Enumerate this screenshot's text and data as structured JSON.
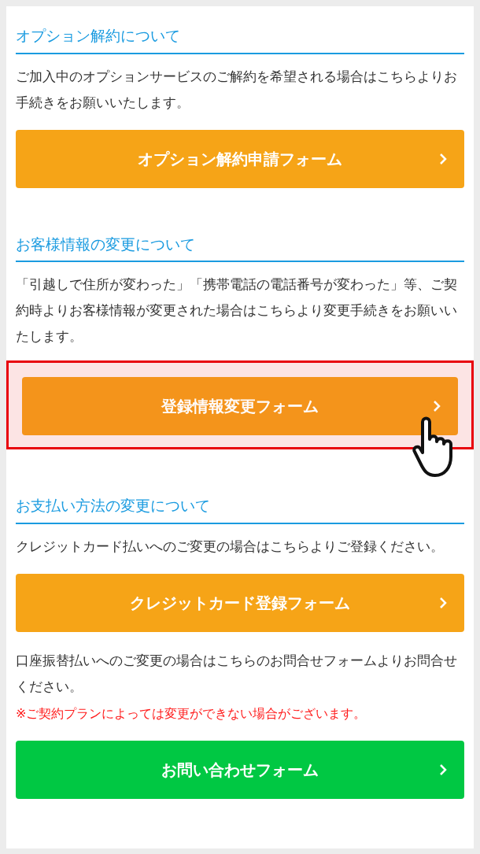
{
  "sections": [
    {
      "heading": "オプション解約について",
      "items": [
        {
          "kind": "text",
          "text": "ご加入中のオプションサービスのご解約を希望される場合はこちらよりお手続きをお願いいたします。"
        },
        {
          "kind": "button",
          "label": "オプション解約申請フォーム",
          "highlighted": false
        }
      ]
    },
    {
      "heading": "お客様情報の変更について",
      "items": [
        {
          "kind": "text",
          "text": "「引越しで住所が変わった」「携帯電話の電話番号が変わった」等、ご契約時よりお客様情報が変更された場合はこちらより変更手続きをお願いいたします。"
        },
        {
          "kind": "button",
          "label": "登録情報変更フォーム",
          "highlighted": true
        }
      ]
    },
    {
      "heading": "お支払い方法の変更について",
      "items": [
        {
          "kind": "text",
          "text": "クレジットカード払いへのご変更の場合はこちらよりご登録ください。"
        },
        {
          "kind": "button",
          "label": "クレジットカード登録フォーム",
          "highlighted": false
        },
        {
          "kind": "text",
          "text": "口座振替払いへのご変更の場合はこちらのお問合せフォームよりお問合せください。"
        },
        {
          "kind": "note",
          "text": "※ご契約プランによっては変更ができない場合がございます。"
        },
        {
          "kind": "contact_button",
          "label": "お問い合わせフォーム",
          "highlighted": false
        }
      ]
    }
  ]
}
